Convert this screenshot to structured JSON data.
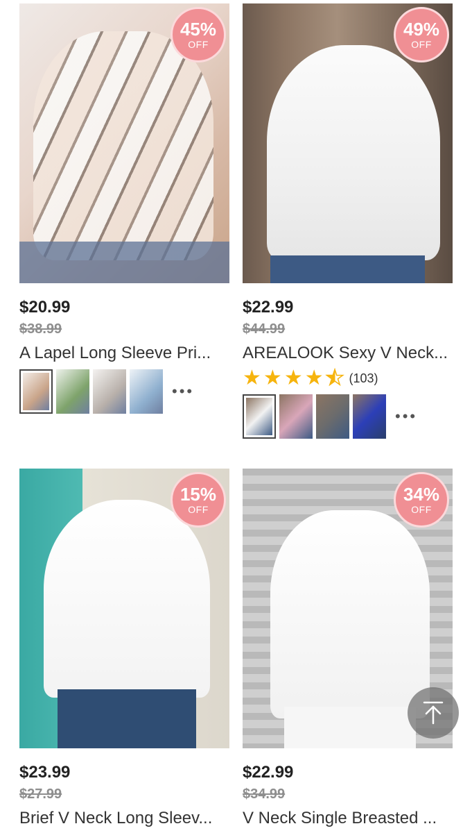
{
  "products": [
    {
      "discount_pct": "45%",
      "discount_off": "OFF",
      "price": "$20.99",
      "original_price": "$38.99",
      "title": "A Lapel Long Sleeve Pri...",
      "swatch_colors": [
        "#c9a489",
        "#7ea36b",
        "#b8b0aa",
        "#8fb0cf"
      ],
      "more": "•••"
    },
    {
      "discount_pct": "49%",
      "discount_off": "OFF",
      "price": "$22.99",
      "original_price": "$44.99",
      "title": "AREALOOK Sexy V Neck...",
      "rating": 4.5,
      "rating_count": "(103)",
      "swatch_colors": [
        "#f2f2f2",
        "#d9a6b9",
        "#6c6c6c",
        "#2c3fb8"
      ],
      "more": "•••"
    },
    {
      "discount_pct": "15%",
      "discount_off": "OFF",
      "price": "$23.99",
      "original_price": "$27.99",
      "title": "Brief V Neck Long Sleev..."
    },
    {
      "discount_pct": "34%",
      "discount_off": "OFF",
      "price": "$22.99",
      "original_price": "$34.99",
      "title": "V Neck Single Breasted ..."
    }
  ],
  "back_to_top": {
    "icon": "arrow-up-icon"
  },
  "colors": {
    "badge": "#f08f94",
    "star": "#f6b40e",
    "price": "#222222",
    "original_price": "#8e8e8e"
  }
}
